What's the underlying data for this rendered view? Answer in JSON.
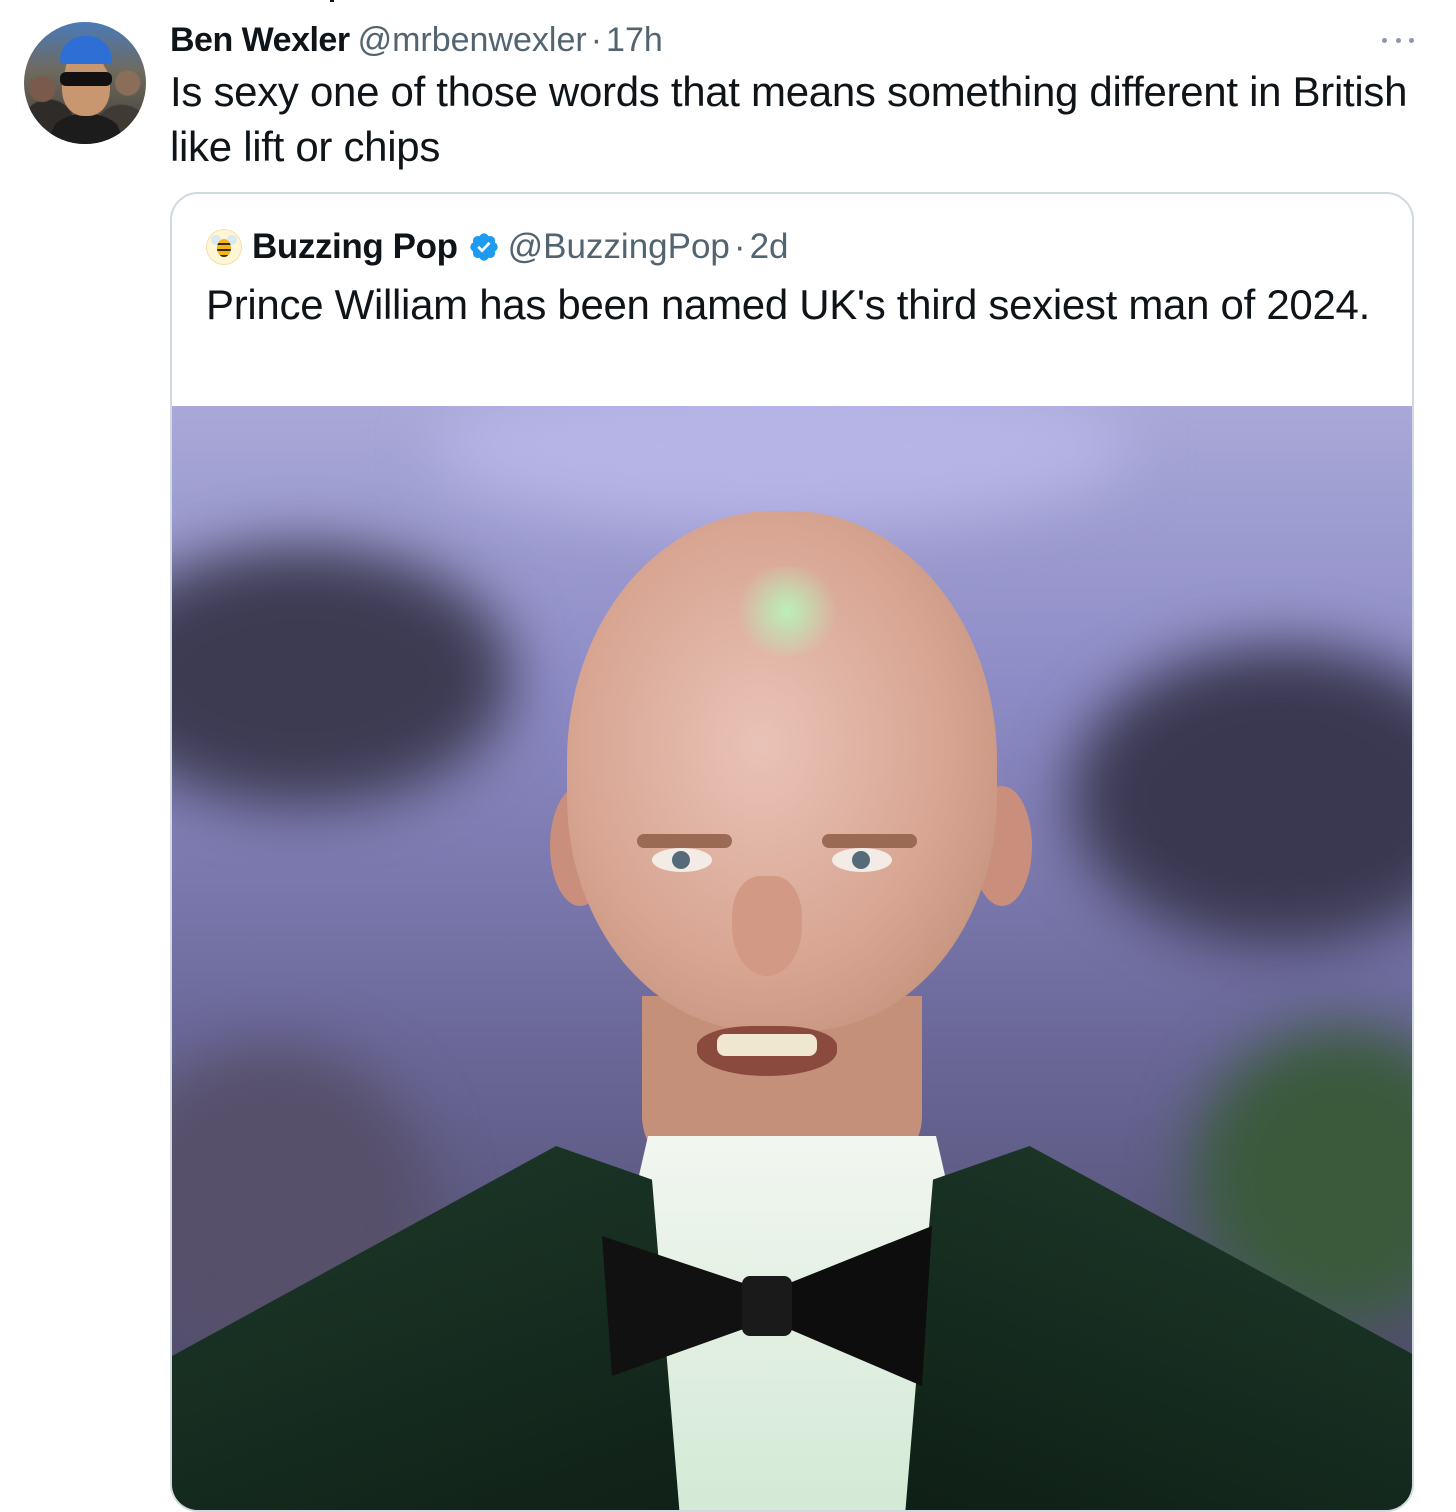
{
  "tweet": {
    "author_name": "Ben Wexler",
    "handle": "@mrbenwexler",
    "separator": "·",
    "time": "17h",
    "text": "Is sexy one of those words that means something different in British like lift or chips"
  },
  "quoted_tweet": {
    "author_name": "Buzzing Pop",
    "verified": true,
    "handle": "@BuzzingPop",
    "separator": "·",
    "time": "2d",
    "text": "Prince William has been named UK's third sexiest man of 2024."
  },
  "icons": {
    "more": "more-horizontal-icon",
    "verified": "verified-badge-icon",
    "quoted_avatar": "bee-avatar-icon"
  },
  "colors": {
    "text_primary": "#0f1419",
    "text_muted": "#536471",
    "verified_blue": "#1d9bf0",
    "card_border": "#cfd9de"
  }
}
